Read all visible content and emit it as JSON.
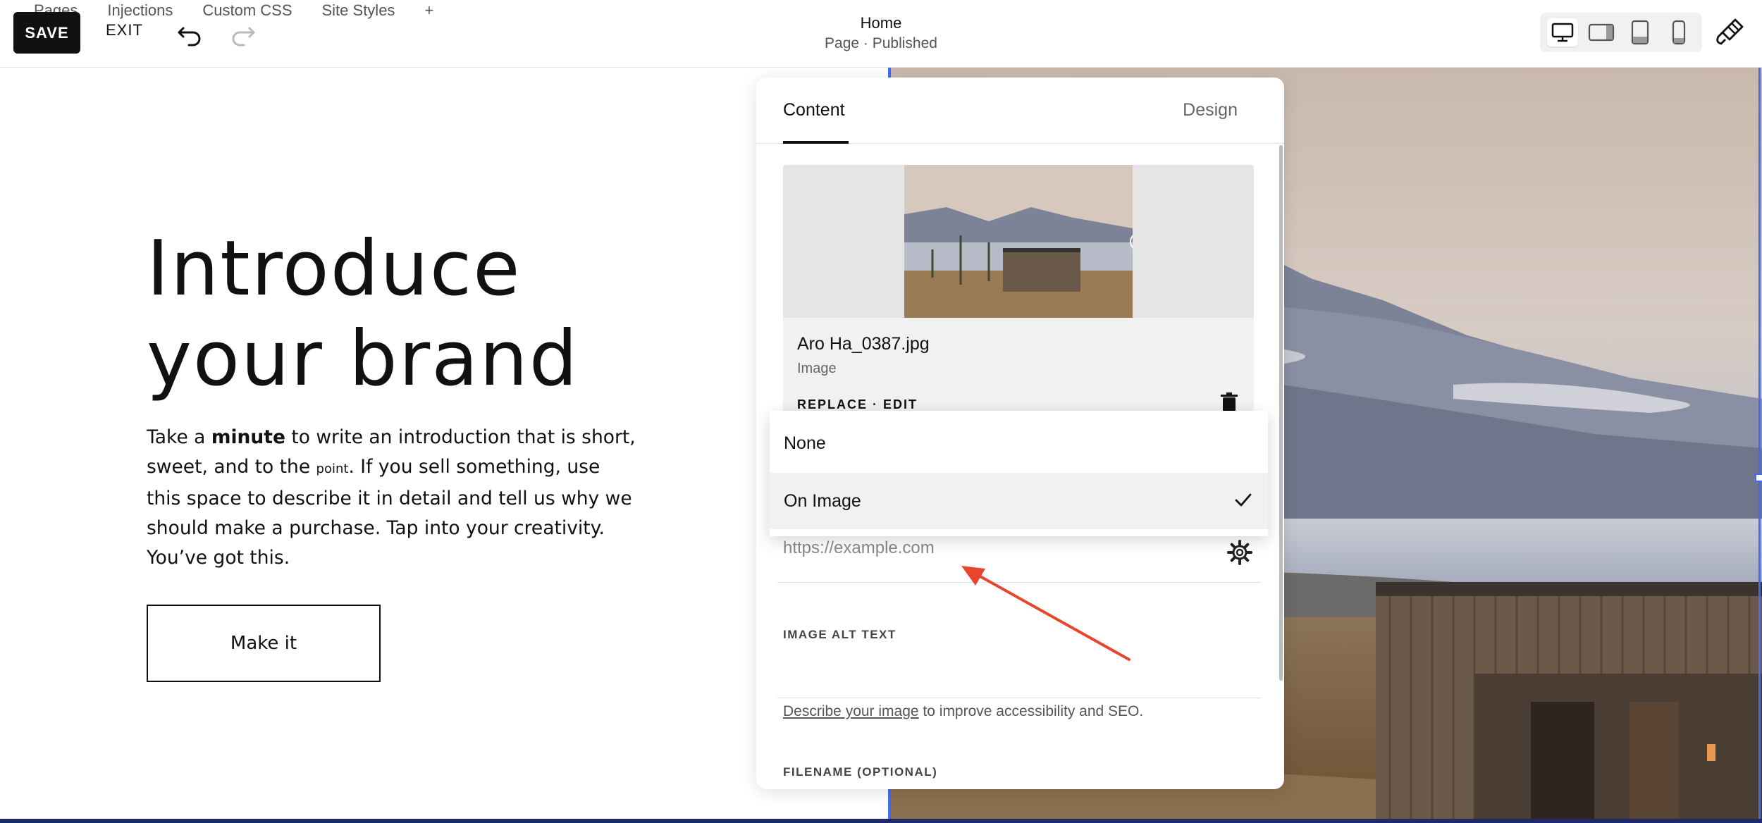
{
  "toolbar": {
    "tabs": [
      "Pages",
      "Injections",
      "Custom CSS",
      "Site Styles"
    ],
    "add_tab": "+",
    "save_label": "SAVE",
    "exit_label": "EXIT",
    "page_title": "Home",
    "page_status": "Page · Published",
    "devices": [
      "desktop-icon",
      "tablet-landscape-icon",
      "tablet-portrait-icon",
      "phone-icon"
    ],
    "active_device": "desktop"
  },
  "hero": {
    "title_line1": "Introduce",
    "title_line2": "your brand",
    "body_part1": "Take a ",
    "body_bold": "minute",
    "body_part2": " to write an introduction that is short, sweet, and to the ",
    "body_small": "point",
    "body_part3": ". If you sell something, use this space to describe it in detail and tell us why we should make a purchase. Tap into your creativity. You’ve got this.",
    "button_label": "Make it"
  },
  "panel": {
    "tabs": {
      "content": "Content",
      "design": "Design"
    },
    "active_tab": "Content",
    "image": {
      "file_name": "Aro Ha_0387.jpg",
      "file_type": "Image",
      "actions": "REPLACE · EDIT"
    },
    "link_placeholder": "https://example.com",
    "alt_text_label": "IMAGE ALT TEXT",
    "alt_help_link": "Describe your image",
    "alt_help_text": " to improve accessibility and SEO.",
    "filename_label": "FILENAME (OPTIONAL)"
  },
  "dropdown": {
    "options": [
      "None",
      "On Image"
    ],
    "selected": "On Image"
  },
  "colors": {
    "selection": "#3b6ef5",
    "annotation_arrow": "#e8452c",
    "save_button": "#111111"
  }
}
